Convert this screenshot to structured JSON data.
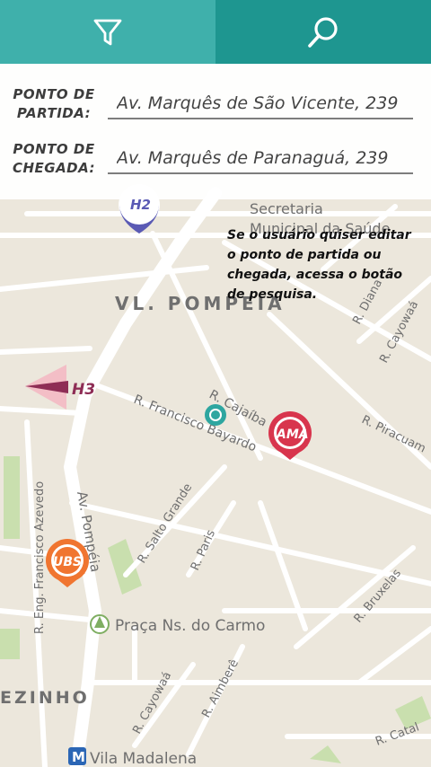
{
  "toolbar": {
    "filter_icon": "filter-funnel-icon",
    "search_icon": "magnifier-search-icon",
    "filter_color": "#3fb0ab",
    "search_color": "#1e9690"
  },
  "route_form": {
    "start": {
      "label": "PONTO DE PARTIDA:",
      "value": "Av. Marquês de São Vicente, 239"
    },
    "end": {
      "label": "PONTO DE CHEGADA:",
      "value": "Av. Marquês de Paranaguá, 239"
    }
  },
  "annotation": "Se o usuário quiser editar o ponto de partida ou chegada, acessa o botão de pesquisa.",
  "map": {
    "neighborhood": "VL. POMPEIA",
    "neighborhood_2": "EZINHO",
    "place_secretaria": "Secretaria",
    "place_secretaria_2": "Municipal da Saúde",
    "place_praca": "Praça Ns. do Carmo",
    "place_metro": "Vila Madalena",
    "metro_icon": "M",
    "streets": {
      "cajaiba": "R. Cajaíba",
      "francisco_bayardo": "R. Francisco Bayardo",
      "av_pompeia": "Av. Pompéia",
      "eng_francisco": "R. Eng. Francisco Azevedo",
      "salto_grande": "R. Salto Grande",
      "paris": "R. Paris",
      "piracuama": "R. Piracuam",
      "diana": "R. Diana",
      "cayowaa": "R. Cayowaá",
      "bruxelas": "R. Bruxelas",
      "aimbere": "R. Aimberê",
      "cayowaa_2": "R. Cayowaá",
      "catalao": "R. Catal"
    },
    "markers": {
      "h2": "H2",
      "h3": "H3",
      "ama": "AMA",
      "ubs": "UBS"
    },
    "colors": {
      "h2": "#5a5ab4",
      "h3": "#8e2d55",
      "ama": "#d8354d",
      "ubs": "#f07530",
      "user_dot": "#2ea6a0"
    }
  }
}
